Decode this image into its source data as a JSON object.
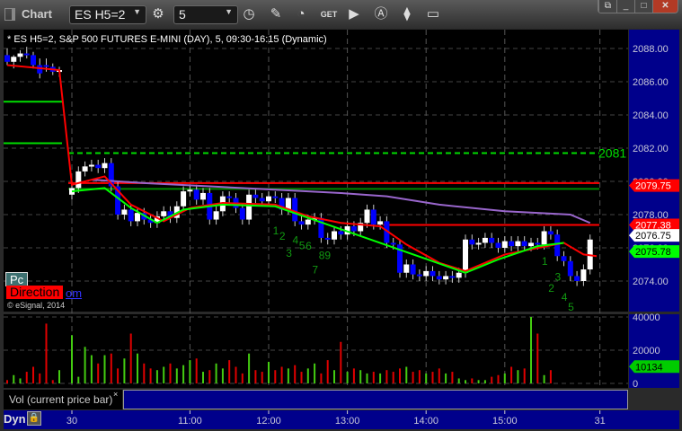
{
  "window": {
    "title": "Chart",
    "symbol": "ES H5=2",
    "interval": "5"
  },
  "toolbar_icons": [
    "settings-icon",
    "clock-icon",
    "pencil-icon",
    "study-icon",
    "get-icon",
    "play-icon",
    "autoscale-icon",
    "link-icon",
    "comment-icon"
  ],
  "header": "* ES H5=2, S&P 500 FUTURES E-MINI (DAY), 5, 09:30-16:15 (Dynamic)",
  "overlays": {
    "pc": "Pc",
    "direction": "Direction",
    "om": "om",
    "copyright": "© eSignal, 2014",
    "level_label": "2081"
  },
  "annotations": [
    {
      "t": "1",
      "bar": 41
    },
    {
      "t": "2",
      "bar": 42
    },
    {
      "t": "3",
      "bar": 43
    },
    {
      "t": "4",
      "bar": 44
    },
    {
      "t": "5",
      "bar": 45
    },
    {
      "t": "6",
      "bar": 46
    },
    {
      "t": "7",
      "bar": 47
    },
    {
      "t": "89",
      "bar": 48
    },
    {
      "t": "1",
      "bar": 82
    },
    {
      "t": "2",
      "bar": 83
    },
    {
      "t": "3",
      "bar": 84
    },
    {
      "t": "4",
      "bar": 85
    },
    {
      "t": "5",
      "bar": 86
    }
  ],
  "colors": {
    "up": "#ffffff",
    "down": "#0000ff",
    "vol_up": "#44cc11",
    "vol_down": "#e00000",
    "axis_bg": "#00008b"
  },
  "chart_data": {
    "type": "candlestick",
    "price_axis": {
      "ylim": [
        2072.8,
        2089.2
      ],
      "ticks": [
        "2088.00",
        "2086.00",
        "2084.00",
        "2082.00",
        "2080.00",
        "2078.00",
        "2076.00",
        "2074.00"
      ]
    },
    "badges": [
      {
        "label": "2079.75",
        "price": 2079.75,
        "color": "#ff0000",
        "text": "#ffffff"
      },
      {
        "label": "2077.38",
        "price": 2077.38,
        "color": "#ff0000",
        "text": "#ffffff"
      },
      {
        "label": "2076.75",
        "price": 2076.75,
        "color": "#ffffff",
        "text": "#000000"
      },
      {
        "label": "2075.78",
        "price": 2075.78,
        "color": "#00ff00",
        "text": "#000000"
      }
    ],
    "prior_day": [
      [
        2087.6,
        2088,
        2087,
        2087.2
      ],
      [
        2087.2,
        2087.6,
        2086.8,
        2087.5
      ],
      [
        2087.5,
        2087.9,
        2087.2,
        2087.7
      ],
      [
        2087.7,
        2088.1,
        2087.4,
        2087.6
      ],
      [
        2087.6,
        2087.8,
        2086.8,
        2087
      ],
      [
        2087,
        2087.4,
        2086.2,
        2086.5
      ],
      [
        2087,
        2087.4,
        2086.6,
        2086.9
      ],
      [
        2086.9,
        2087.1,
        2086.4,
        2086.6
      ],
      [
        2086.6,
        2086.9,
        2086.3,
        2086.7
      ]
    ],
    "today_open": 2079.2,
    "closes": [
      2079.6,
      2080.6,
      2080.9,
      2081.0,
      2080.8,
      2081.1,
      2079.7,
      2078.0,
      2078.3,
      2077.6,
      2078.1,
      2077.7,
      2077.5,
      2077.9,
      2078.2,
      2077.8,
      2078.5,
      2079.4,
      2079.5,
      2078.9,
      2079.3,
      2077.7,
      2078.2,
      2079.1,
      2079.0,
      2078.4,
      2077.7,
      2079.2,
      2079.0,
      2078.8,
      2079.1,
      2079.0,
      2078.3,
      2079.0,
      2077.6,
      2077.4,
      2077.7,
      2077.8,
      2076.6,
      2076.5,
      2077.0,
      2076.8,
      2077.3,
      2077.0,
      2077.5,
      2078.3,
      2077.4,
      2077.6,
      2076.3,
      2076.2,
      2074.5,
      2075.0,
      2074.4,
      2074.3,
      2074.6,
      2074.3,
      2074.1,
      2074.3,
      2074.2,
      2074.5,
      2076.5,
      2076.2,
      2076.3,
      2076.6,
      2076.3,
      2076.0,
      2076.4,
      2076.1,
      2076.4,
      2076.1,
      2076.3,
      2076.2,
      2077.0,
      2076.8,
      2075.5,
      2075.2,
      2074.3,
      2074.0,
      2074.7,
      2076.5
    ],
    "volume": [
      2000,
      5000,
      3000,
      7000,
      10000,
      6000,
      36000,
      2000,
      8000,
      29000,
      4000,
      22000,
      17000,
      12000,
      17000,
      18000,
      9000,
      15000,
      30000,
      18000,
      12000,
      9000,
      8000,
      10000,
      12000,
      9000,
      11000,
      14000,
      15000,
      7000,
      8000,
      12000,
      9000,
      14000,
      10000,
      6000,
      18000,
      8000,
      7000,
      13000,
      8000,
      10000,
      9000,
      11000,
      7000,
      9000,
      12000,
      6000,
      14000,
      8000,
      25000,
      7000,
      9000,
      8000,
      6000,
      7000,
      6000,
      8000,
      7000,
      9000,
      10000,
      7000,
      8000,
      6000,
      7000,
      9000,
      6000,
      7000,
      3000,
      2000,
      3000,
      2000,
      2000,
      4000,
      5000,
      6000,
      10000,
      8000,
      9000,
      40000,
      30000,
      5000,
      8000
    ],
    "vol_axis": {
      "ticks": [
        "40000",
        "20000",
        "0"
      ],
      "ylim": [
        0,
        40000
      ],
      "current": "10134"
    },
    "levels": [
      {
        "price": 2084.8,
        "from": 0,
        "to": 8,
        "color": "#00dd00",
        "dash": false
      },
      {
        "price": 2082.3,
        "from": 0,
        "to": 8,
        "color": "#00dd00",
        "dash": false
      },
      {
        "price": 2081.7,
        "from": 9,
        "to": 89,
        "color": "#00dd00",
        "dash": true
      },
      {
        "price": 2079.55,
        "from": 9,
        "to": 89,
        "color": "#008800",
        "dash": false
      },
      {
        "price": 2079.9,
        "from": 9,
        "to": 89,
        "color": "#ff0000",
        "dash": false
      },
      {
        "price": 2077.38,
        "from": 57,
        "to": 89,
        "color": "#ff0000",
        "dash": false
      }
    ],
    "lines": [
      {
        "name": "purple-ma",
        "color": "#9966cc",
        "pts": [
          [
            12,
            2080.1
          ],
          [
            20,
            2079.9
          ],
          [
            30,
            2079.7
          ],
          [
            40,
            2079.5
          ],
          [
            50,
            2079.3
          ],
          [
            57,
            2079.1
          ],
          [
            65,
            2078.6
          ],
          [
            75,
            2078.2
          ],
          [
            85,
            2078.0
          ],
          [
            88,
            2077.5
          ]
        ]
      },
      {
        "name": "red-ma",
        "color": "#ff0000",
        "pts": [
          [
            0,
            2087.0
          ],
          [
            8,
            2086.7
          ],
          [
            9,
            2079.8
          ],
          [
            14,
            2080.3
          ],
          [
            18,
            2078.6
          ],
          [
            23,
            2077.6
          ],
          [
            27,
            2078.4
          ],
          [
            32,
            2078.7
          ],
          [
            40,
            2078.6
          ],
          [
            45,
            2077.9
          ],
          [
            50,
            2077.5
          ],
          [
            56,
            2077.3
          ],
          [
            60,
            2076.2
          ],
          [
            65,
            2075.1
          ],
          [
            69,
            2074.6
          ],
          [
            75,
            2075.6
          ],
          [
            84,
            2076.3
          ],
          [
            87,
            2075.6
          ],
          [
            89,
            2075.5
          ]
        ]
      },
      {
        "name": "green-ma",
        "color": "#00ff00",
        "pts": [
          [
            9,
            2079.4
          ],
          [
            14,
            2079.6
          ],
          [
            18,
            2078.4
          ],
          [
            22,
            2077.5
          ],
          [
            26,
            2078.3
          ],
          [
            32,
            2078.6
          ],
          [
            40,
            2078.5
          ],
          [
            69,
            2074.5
          ],
          [
            74,
            2075.3
          ],
          [
            80,
            2076.1
          ],
          [
            84,
            2076.3
          ]
        ]
      }
    ],
    "time_axis": [
      {
        "label": "30",
        "bar": 9
      },
      {
        "label": "11:00",
        "bar": 27
      },
      {
        "label": "12:00",
        "bar": 39
      },
      {
        "label": "13:00",
        "bar": 51
      },
      {
        "label": "14:00",
        "bar": 63
      },
      {
        "label": "15:00",
        "bar": 75
      },
      {
        "label": "31",
        "bar": 89.5
      }
    ]
  },
  "volume_panel": {
    "label": "Vol (current price bar)",
    "close": "×"
  },
  "footer": {
    "dyn": "Dyn"
  }
}
